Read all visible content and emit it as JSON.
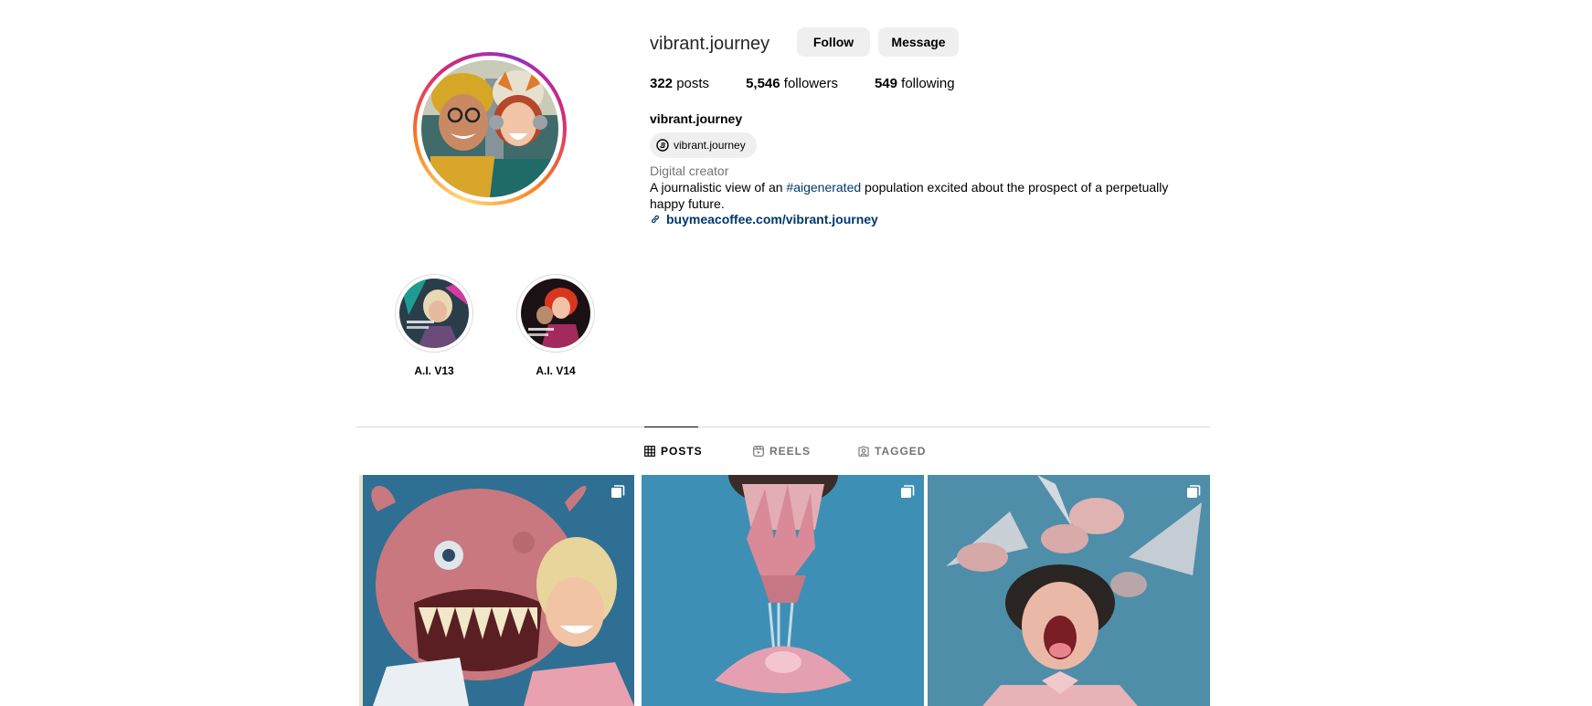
{
  "profile": {
    "username": "vibrant.journey",
    "full_name": "vibrant.journey",
    "threads_handle": "vibrant.journey",
    "category": "Digital creator",
    "bio": {
      "part1": "A journalistic view of an ",
      "hashtag": "#aigenerated",
      "part2": " population excited about the prospect of a perpetually happy future."
    },
    "link": "buymeacoffee.com/vibrant.journey"
  },
  "actions": {
    "follow_label": "Follow",
    "message_label": "Message"
  },
  "stats": {
    "posts_count": "322",
    "posts_label": " posts",
    "followers_count": "5,546",
    "followers_label": " followers",
    "following_count": "549",
    "following_label": " following"
  },
  "highlights": [
    {
      "label": "A.I. V13"
    },
    {
      "label": "A.I. V14"
    }
  ],
  "tabs": [
    {
      "label": "POSTS",
      "icon": "grid-icon",
      "active": true
    },
    {
      "label": "REELS",
      "icon": "reels-icon",
      "active": false
    },
    {
      "label": "TAGGED",
      "icon": "tagged-icon",
      "active": false
    }
  ],
  "posts": [
    {
      "icon": "carousel-icon"
    },
    {
      "icon": "carousel-icon"
    },
    {
      "icon": "carousel-icon"
    }
  ],
  "colors": {
    "link": "#00376b",
    "button_bg": "#efefef",
    "secondary_text": "#737373",
    "divider": "#dbdbdb"
  }
}
